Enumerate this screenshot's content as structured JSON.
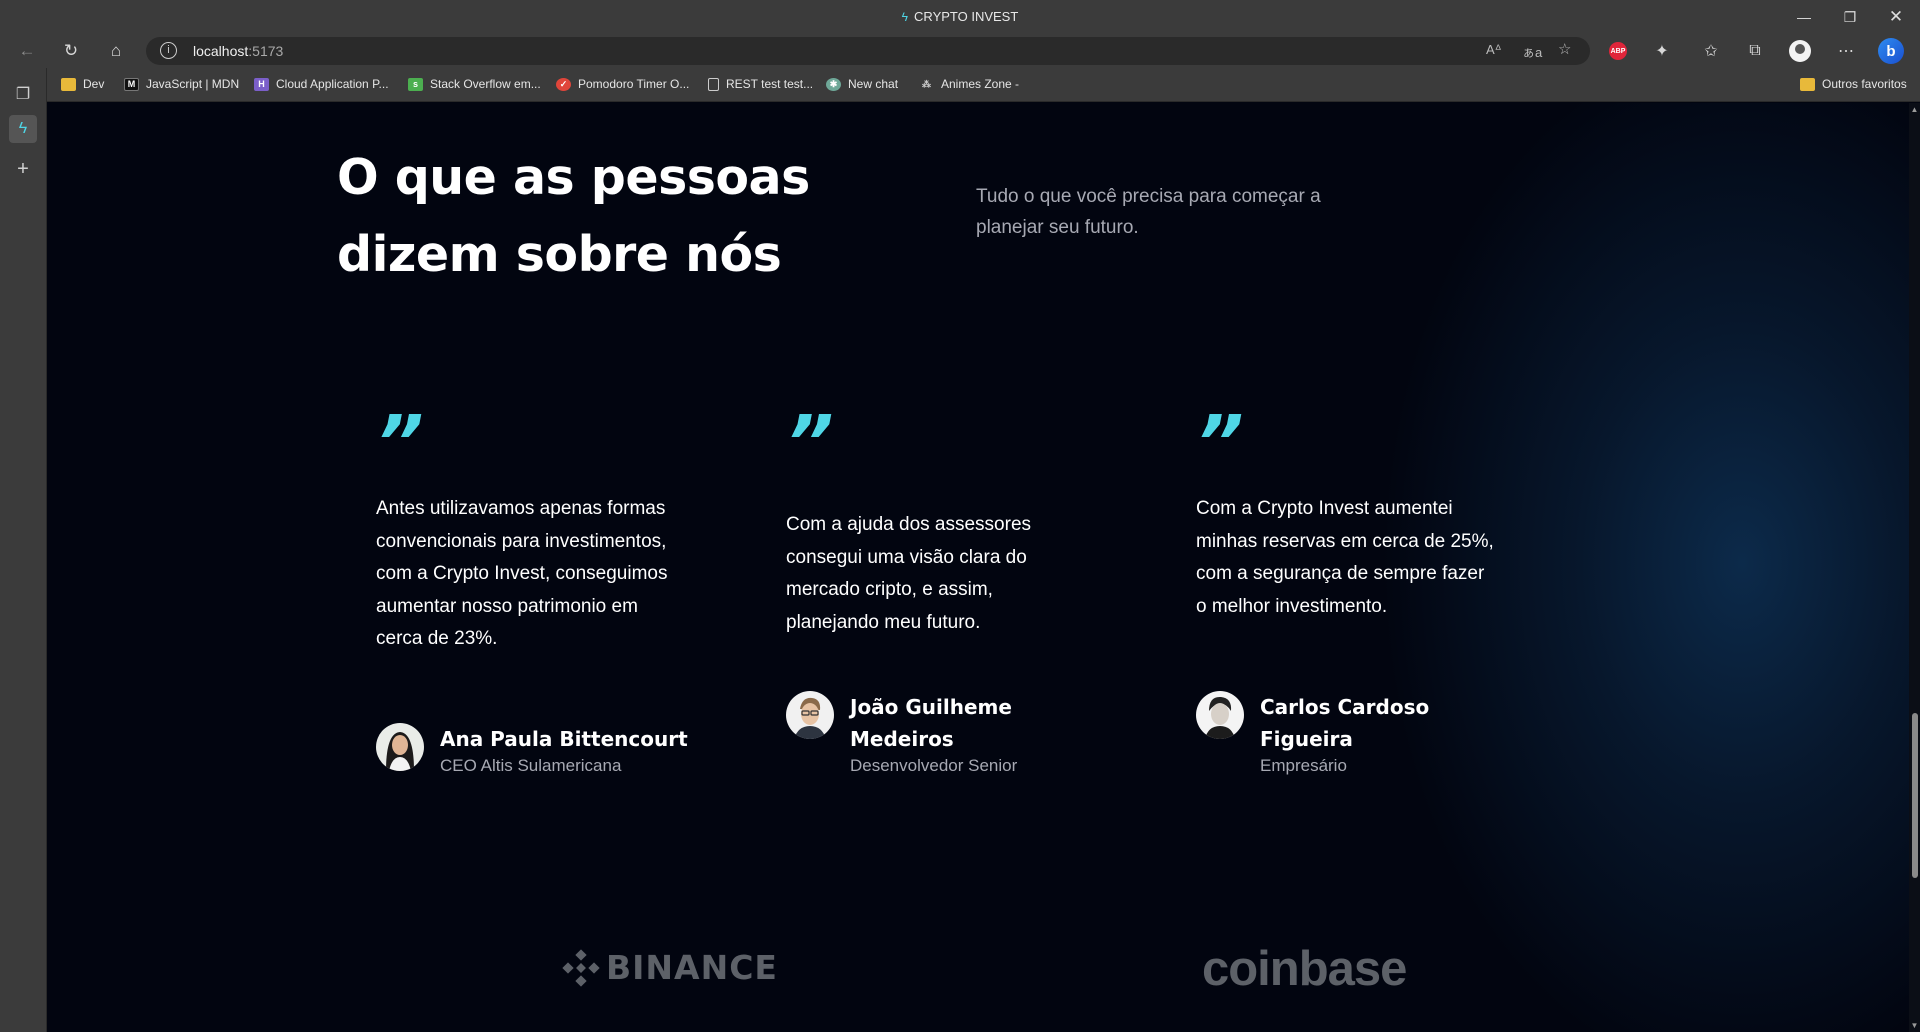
{
  "window": {
    "title": "CRYPTO INVEST"
  },
  "address_bar": {
    "host": "localhost",
    "port": ":5173"
  },
  "bookmarks": [
    {
      "label": "Dev",
      "icon": "folder-icon",
      "color": "#e8b93a"
    },
    {
      "label": "JavaScript | MDN",
      "icon": "mdn-icon",
      "color": "#111111"
    },
    {
      "label": "Cloud Application P...",
      "icon": "heroku-icon",
      "color": "#7b5fc9"
    },
    {
      "label": "Stack Overflow em...",
      "icon": "stackoverflow-icon",
      "color": "#4caf50"
    },
    {
      "label": "Pomodoro Timer O...",
      "icon": "pomodoro-icon",
      "color": "#e0453a"
    },
    {
      "label": "REST test test...",
      "icon": "page-icon",
      "color": "#3b3b3b"
    },
    {
      "label": "New chat",
      "icon": "chatgpt-icon",
      "color": "#6fa898"
    },
    {
      "label": "Animes Zone -",
      "icon": "anime-icon",
      "color": "#3b3b3b"
    }
  ],
  "other_favorites": "Outros favoritos",
  "section": {
    "heading_line1": "O que as pessoas",
    "heading_line2": "dizem sobre nós",
    "subtitle": "Tudo o que você precisa para começar a planejar seu futuro."
  },
  "testimonials": [
    {
      "quote_mark": "”",
      "text": "Antes utilizavamos apenas formas convencionais para investimentos, com a Crypto Invest, conseguimos aumentar nosso patrimonio em cerca de 23%.",
      "name": "Ana Paula Bittencourt",
      "role": "CEO Altis Sulamericana"
    },
    {
      "quote_mark": "”",
      "text": "Com a ajuda dos assessores consegui uma visão clara do mercado cripto, e assim, planejando meu futuro.",
      "name": "João Guilheme Medeiros",
      "role": "Desenvolvedor Senior"
    },
    {
      "quote_mark": "”",
      "text": "Com a Crypto Invest aumentei minhas reservas em cerca de 25%, com a segurança de sempre fazer o melhor investimento.",
      "name": "Carlos Cardoso Figueira",
      "role": "Empresário"
    }
  ],
  "partners": {
    "binance": "BINANCE",
    "coinbase": "coinbase"
  },
  "colors": {
    "accent": "#4fd6e6",
    "background": "#020510",
    "muted_text": "#a7a9b3",
    "logo_gray": "#5d6168"
  }
}
